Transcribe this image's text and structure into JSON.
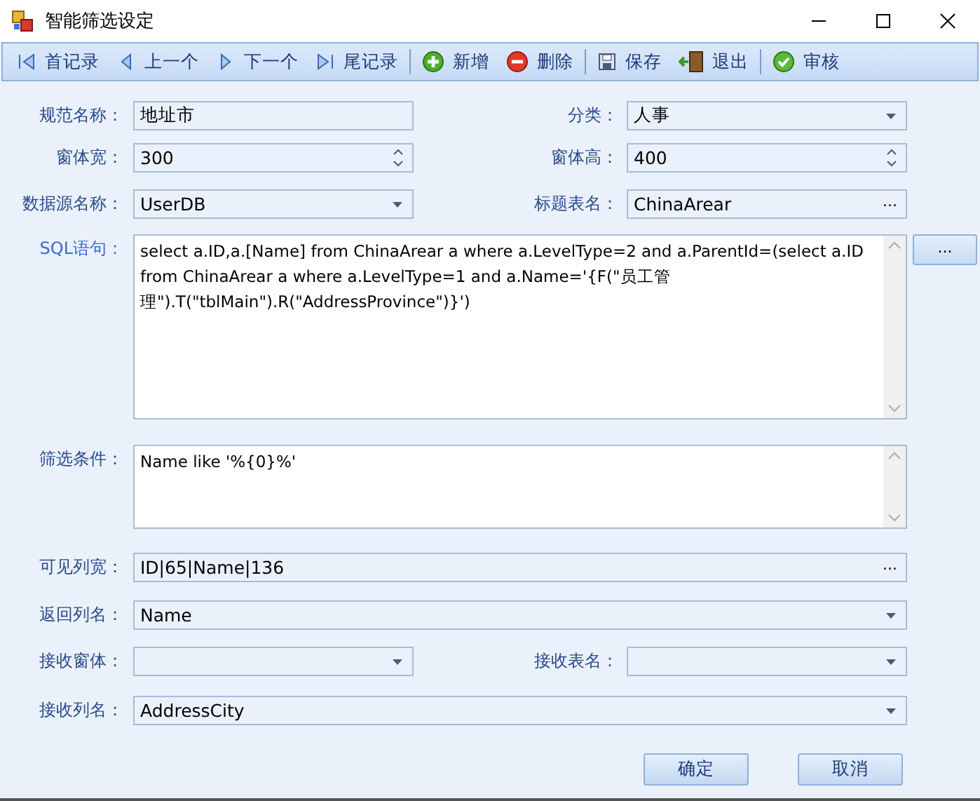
{
  "window": {
    "title": "智能筛选设定"
  },
  "toolbar": [
    {
      "kind": "first",
      "label": "首记录"
    },
    {
      "kind": "prev",
      "label": "上一个"
    },
    {
      "kind": "next",
      "label": "下一个"
    },
    {
      "kind": "last",
      "label": "尾记录"
    },
    {
      "kind": "separator"
    },
    {
      "kind": "add",
      "label": "新增"
    },
    {
      "kind": "delete",
      "label": "删除"
    },
    {
      "kind": "separator"
    },
    {
      "kind": "save",
      "label": "保存"
    },
    {
      "kind": "exit",
      "label": "退出"
    },
    {
      "kind": "separator"
    },
    {
      "kind": "approve",
      "label": "审核"
    }
  ],
  "form_rows": [
    {
      "fields": [
        {
          "label": "规范名称：",
          "kind": "text",
          "value": "地址市"
        },
        {
          "label": "分类：",
          "kind": "combo",
          "value": "人事"
        }
      ]
    },
    {
      "fields": [
        {
          "label": "窗体宽：",
          "kind": "spin",
          "value": "300"
        },
        {
          "label": "窗体高：",
          "kind": "spin",
          "value": "400"
        }
      ]
    },
    {
      "fields": [
        {
          "label": "数据源名称：",
          "kind": "combo",
          "value": "UserDB"
        },
        {
          "label": "标题表名：",
          "kind": "ellipsis",
          "value": "ChinaArear",
          "button": "..."
        }
      ]
    },
    {
      "fields": [
        {
          "label": "SQL语句：",
          "kind": "memo",
          "value": "select a.ID,a.[Name] from ChinaArear a where a.LevelType=2 and a.ParentId=(select a.ID from ChinaArear a where a.LevelType=1 and a.Name='{F(\"员工管理\").T(\"tblMain\").R(\"AddressProvince\")}')",
          "side_button": "..."
        }
      ]
    },
    {
      "fields": [
        {
          "label": "筛选条件：",
          "kind": "memo",
          "value": "Name like '%{0}%'"
        }
      ]
    },
    {
      "fields": [
        {
          "label": "可见列宽：",
          "kind": "ellipsis",
          "value": "ID|65|Name|136",
          "button": "..."
        }
      ]
    },
    {
      "fields": [
        {
          "label": "返回列名：",
          "kind": "combo",
          "value": "Name"
        }
      ]
    },
    {
      "fields": [
        {
          "label": "接收窗体：",
          "kind": "combo"
        },
        {
          "label": "接收表名：",
          "kind": "combo"
        }
      ]
    },
    {
      "fields": [
        {
          "label": "接收列名：",
          "kind": "combo",
          "value": "AddressCity"
        }
      ]
    }
  ],
  "buttons": [
    "确定",
    "取消"
  ]
}
